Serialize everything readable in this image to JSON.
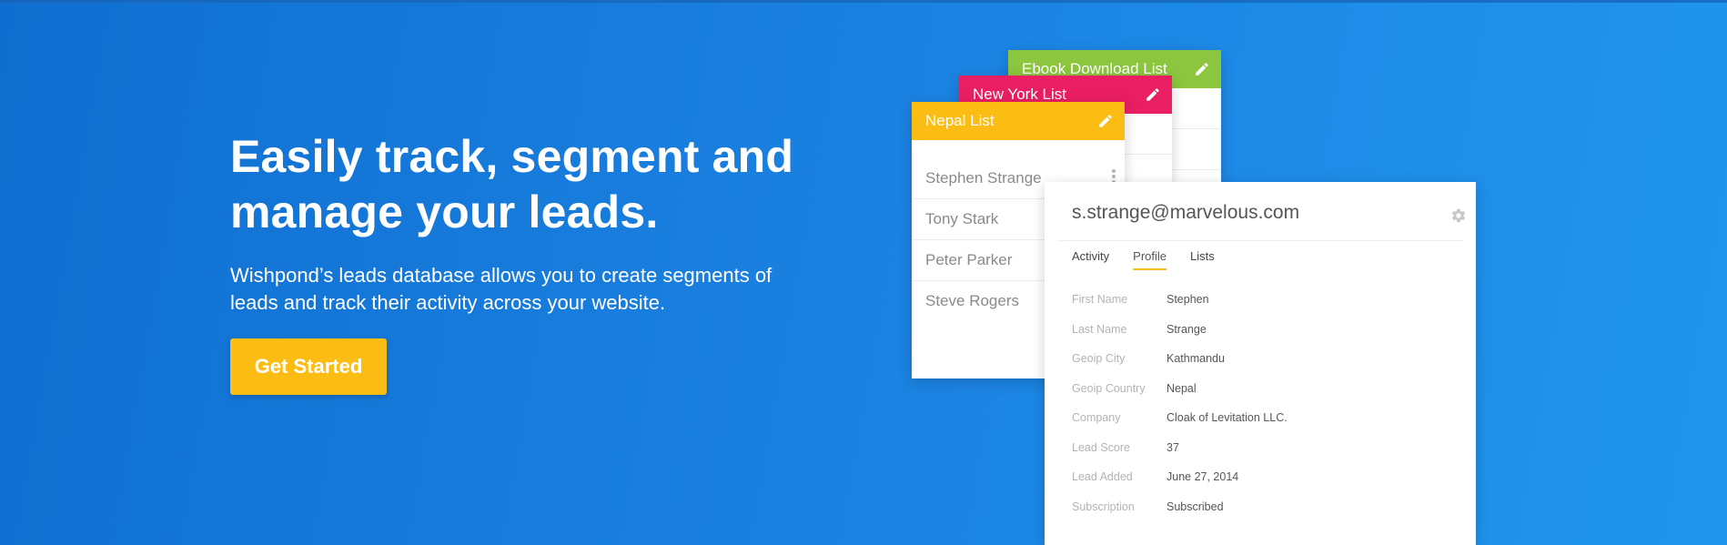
{
  "hero": {
    "title_line1": "Easily track, segment and",
    "title_line2": "manage your leads.",
    "description": "Wishpond’s leads database allows you to create segments of leads and track their activity across your website.",
    "cta_label": "Get Started"
  },
  "lists": {
    "ebook": {
      "title": "Ebook Download List",
      "color": "#8cc63f"
    },
    "newyork": {
      "title": "New York List",
      "color": "#e91e63"
    },
    "nepal": {
      "title": "Nepal List",
      "color": "#fbbd14",
      "leads": [
        "Stephen Strange",
        "Tony Stark",
        "Peter Parker",
        "Steve Rogers"
      ]
    }
  },
  "profile": {
    "email": "s.strange@marvelous.com",
    "tabs": [
      "Activity",
      "Profile",
      "Lists"
    ],
    "active_tab": "Profile",
    "fields": [
      {
        "label": "First Name",
        "value": "Stephen"
      },
      {
        "label": "Last Name",
        "value": "Strange"
      },
      {
        "label": "Geoip City",
        "value": "Kathmandu"
      },
      {
        "label": "Geoip Country",
        "value": "Nepal"
      },
      {
        "label": "Company",
        "value": "Cloak of Levitation LLC."
      },
      {
        "label": "Lead Score",
        "value": "37"
      },
      {
        "label": "Lead Added",
        "value": "June 27, 2014"
      },
      {
        "label": "Subscription",
        "value": "Subscribed"
      }
    ]
  },
  "colors": {
    "accent": "#fbbd14",
    "background": "#1a80e0"
  }
}
